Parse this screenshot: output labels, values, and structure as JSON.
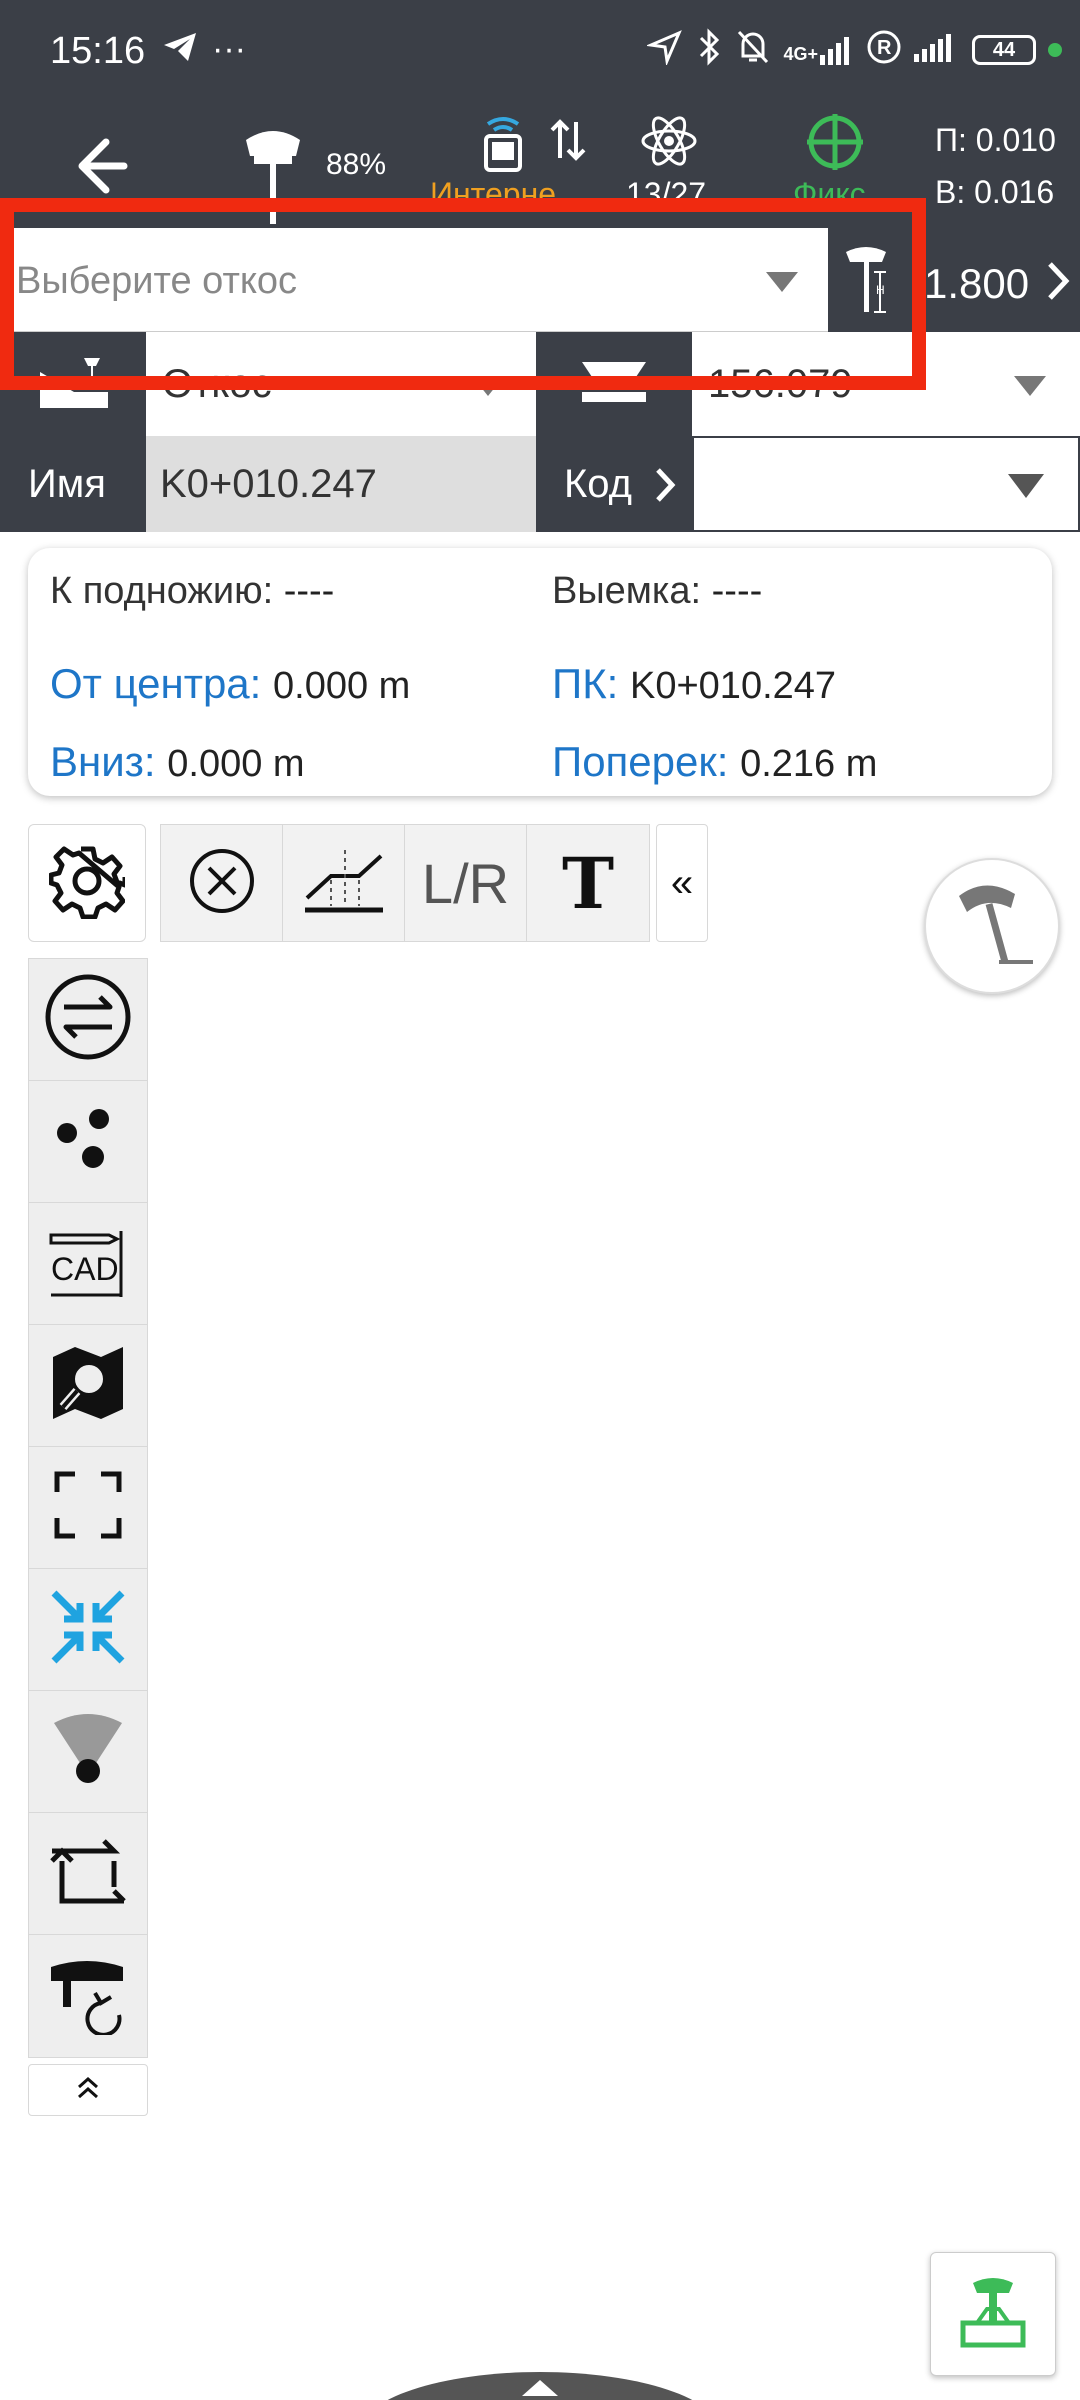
{
  "status_bar": {
    "time": "15:16",
    "more": "···",
    "signal_label": "4G+",
    "battery": "44",
    "dot_color": "#3dbb58"
  },
  "toolbar": {
    "receiver_battery": "88%",
    "network_label": "Интерне",
    "satellites": "13/27",
    "fix_label": "Фикс",
    "precision_h": "П: 0.010",
    "precision_v": "В: 0.016",
    "colors": {
      "network": "#f0a020",
      "fix": "#3dbb58",
      "header_bg": "#3b3f47"
    }
  },
  "slope_selector": {
    "placeholder": "Выберите откос",
    "pole_height": "1.800",
    "highlight_color": "#f02a10"
  },
  "row2": {
    "left_value": "Откос",
    "right_value": "156.079"
  },
  "row3": {
    "name_label": "Имя",
    "name_value": "K0+010.247",
    "code_label": "Код"
  },
  "info_panel": {
    "to_toe_label": "К подножию:",
    "to_toe_value": "----",
    "cut_label": "Выемка:",
    "cut_value": "----",
    "from_center_label": "От центра:",
    "from_center_value": "0.000 m",
    "station_label": "ПК:",
    "station_value": "K0+010.247",
    "down_label": "Вниз:",
    "down_value": "0.000 m",
    "across_label": "Поперек:",
    "across_value": "0.216 m"
  },
  "map_toolbar": {
    "lr_label": "L/R",
    "text_tool_label": "T",
    "collapse_label": "«",
    "cad_label": "CAD"
  }
}
